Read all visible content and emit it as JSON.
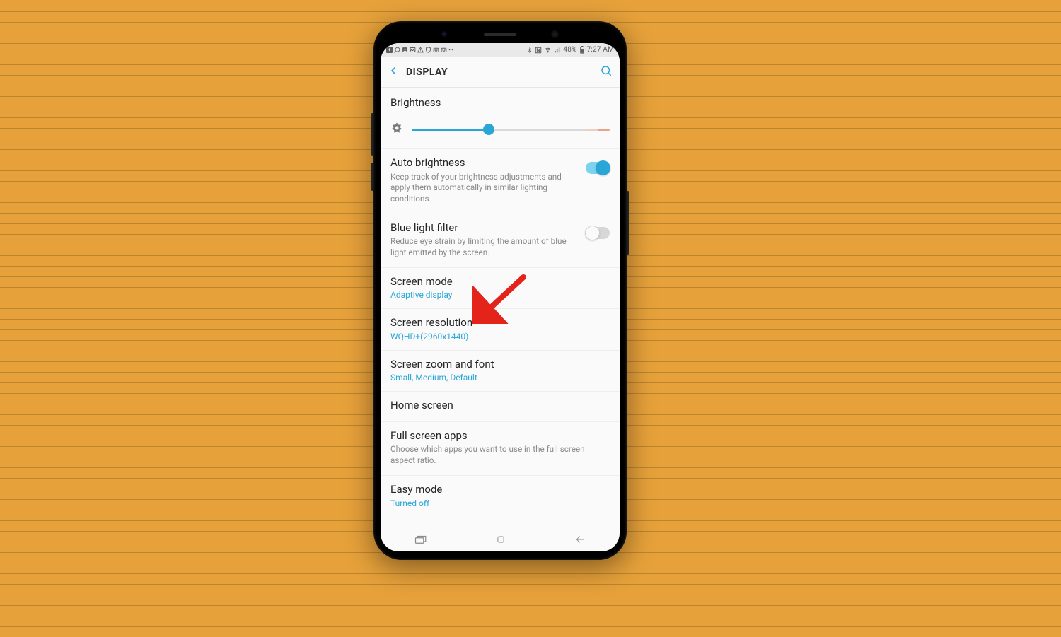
{
  "status": {
    "battery_pct": "48%",
    "time": "7:27 AM"
  },
  "appbar": {
    "title": "DISPLAY"
  },
  "brightness": {
    "title": "Brightness",
    "value_pct": 39
  },
  "rows": {
    "auto_brightness": {
      "title": "Auto brightness",
      "desc": "Keep track of your brightness adjustments and apply them automatically in similar lighting conditions.",
      "on": true
    },
    "blue_light": {
      "title": "Blue light filter",
      "desc": "Reduce eye strain by limiting the amount of blue light emitted by the screen.",
      "on": false
    },
    "screen_mode": {
      "title": "Screen mode",
      "value": "Adaptive display"
    },
    "screen_resolution": {
      "title": "Screen resolution",
      "value": "WQHD+(2960x1440)"
    },
    "zoom_font": {
      "title": "Screen zoom and font",
      "value": "Small, Medium, Default"
    },
    "home_screen": {
      "title": "Home screen"
    },
    "full_screen_apps": {
      "title": "Full screen apps",
      "desc": "Choose which apps you want to use in the full screen aspect ratio."
    },
    "easy_mode": {
      "title": "Easy mode",
      "value": "Turned off"
    }
  }
}
